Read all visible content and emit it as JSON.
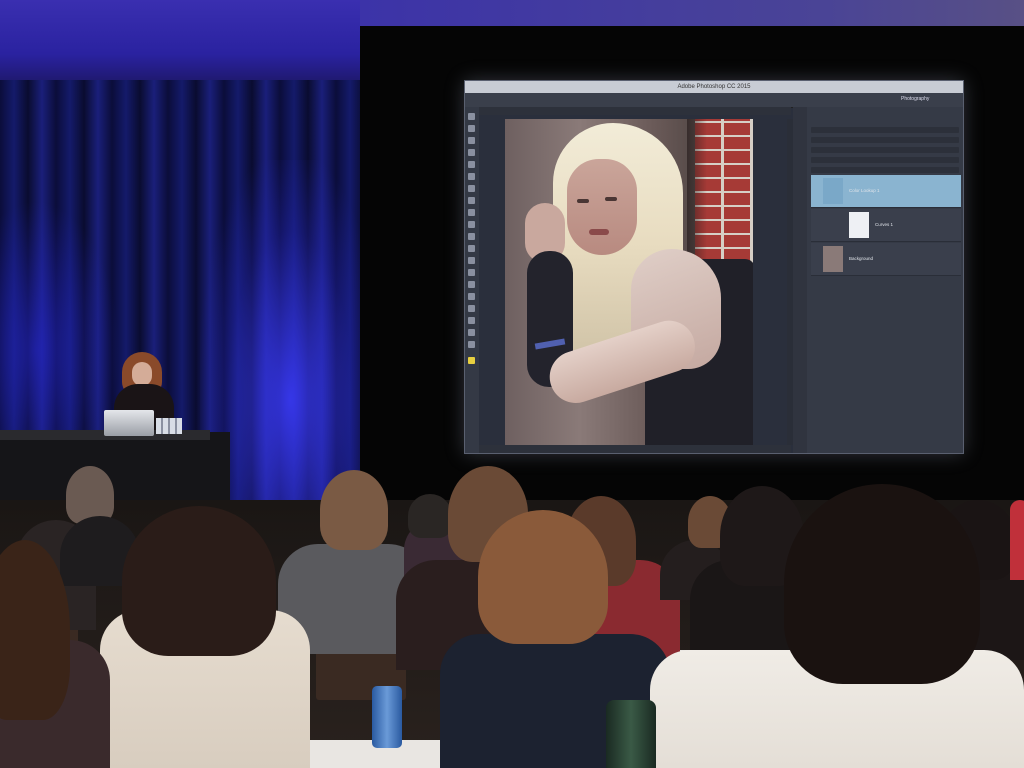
{
  "photoshop": {
    "title": "Adobe Photoshop CC 2015",
    "workspace": "Photography",
    "layers": [
      {
        "name": "Color Lookup 1",
        "active": true
      },
      {
        "name": "Curves 1",
        "active": false
      },
      {
        "name": "Background",
        "active": false
      }
    ]
  },
  "colors": {
    "stage_light": "#2a22d0",
    "screen_bg": "#2a2f3c",
    "active_layer": "#8ab4d0"
  }
}
